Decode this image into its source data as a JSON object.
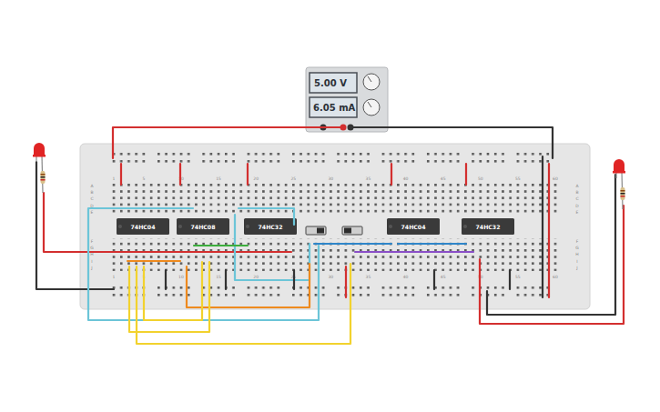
{
  "power_supply": {
    "voltage": "5.00 V",
    "current": "6.05 mA"
  },
  "breadboard": {
    "columns": [
      "1",
      "5",
      "10",
      "15",
      "20",
      "25",
      "30",
      "35",
      "40",
      "45",
      "50",
      "55",
      "60"
    ],
    "rows_top": [
      "A",
      "B",
      "C",
      "D",
      "E"
    ],
    "rows_bottom": [
      "F",
      "G",
      "H",
      "I",
      "J"
    ]
  },
  "chips": [
    {
      "label": "74HC04"
    },
    {
      "label": "74HC08"
    },
    {
      "label": "74HC32"
    },
    {
      "label": "74HC04"
    },
    {
      "label": "74HC32"
    }
  ],
  "switches": [
    {
      "on": true
    },
    {
      "on": false
    }
  ],
  "leds": [
    {
      "color": "#e02424"
    },
    {
      "color": "#e02424"
    }
  ],
  "wires": [
    {
      "color": "#d32f2f"
    },
    {
      "color": "#333333"
    },
    {
      "color": "#d32f2f"
    },
    {
      "color": "#d32f2f"
    },
    {
      "color": "#d32f2f"
    },
    {
      "color": "#d32f2f"
    },
    {
      "color": "#d32f2f"
    },
    {
      "color": "#333333"
    },
    {
      "color": "#d32f2f"
    },
    {
      "color": "#333333"
    },
    {
      "color": "#d32f2f"
    },
    {
      "color": "#333333"
    },
    {
      "color": "#d32f2f"
    },
    {
      "color": "#6cc5d8"
    },
    {
      "color": "#6cc5d8"
    },
    {
      "color": "#6cc5d8"
    },
    {
      "color": "#3dae3d"
    },
    {
      "color": "#2f86c9"
    },
    {
      "color": "#2f86c9"
    },
    {
      "color": "#8a4fc7"
    },
    {
      "color": "#ee8a1e"
    },
    {
      "color": "#ee8a1e"
    },
    {
      "color": "#f2d22e"
    },
    {
      "color": "#f2d22e"
    },
    {
      "color": "#f2d22e"
    },
    {
      "color": "#333333"
    },
    {
      "color": "#333333"
    },
    {
      "color": "#333333"
    },
    {
      "color": "#333333"
    },
    {
      "color": "#333333"
    },
    {
      "color": "#d32f2f"
    }
  ]
}
